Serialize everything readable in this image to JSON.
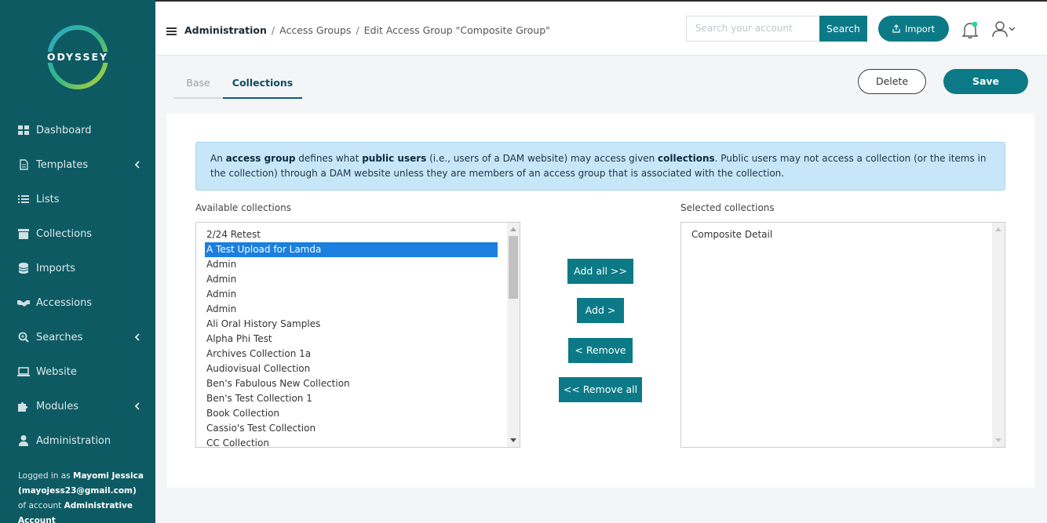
{
  "app": {
    "brand": "ODYSSEY"
  },
  "colors": {
    "sidebar": "#0d5a63",
    "accent": "#0b7a86",
    "selected": "#1b7fe0",
    "info_bg": "#c7e6f8"
  },
  "sidebar": {
    "items": [
      {
        "label": "Dashboard",
        "icon": "dashboard-icon"
      },
      {
        "label": "Templates",
        "icon": "document-icon",
        "has_submenu": true
      },
      {
        "label": "Lists",
        "icon": "list-icon"
      },
      {
        "label": "Collections",
        "icon": "archive-icon"
      },
      {
        "label": "Imports",
        "icon": "database-icon"
      },
      {
        "label": "Accessions",
        "icon": "handshake-icon"
      },
      {
        "label": "Searches",
        "icon": "search-plus-icon",
        "has_submenu": true
      },
      {
        "label": "Website",
        "icon": "laptop-icon"
      },
      {
        "label": "Modules",
        "icon": "puzzle-icon",
        "has_submenu": true
      },
      {
        "label": "Administration",
        "icon": "user-icon"
      }
    ],
    "logged_in": {
      "prefix": "Logged in as",
      "name": "Mayomi Jessica",
      "email": "(mayojess23@gmail.com)",
      "of_account": "of account",
      "account": "Administrative Account"
    }
  },
  "header": {
    "breadcrumb": {
      "root": "Administration",
      "sep": "/",
      "level2": "Access Groups",
      "current": "Edit Access Group \"Composite Group\""
    },
    "search": {
      "placeholder": "Search your account",
      "button": "Search"
    },
    "import_label": "Import"
  },
  "tabs": [
    {
      "label": "Base",
      "active": false
    },
    {
      "label": "Collections",
      "active": true
    }
  ],
  "actions": {
    "delete": "Delete",
    "save": "Save"
  },
  "info": {
    "t1": "An ",
    "b1": "access group",
    "t2": " defines what ",
    "b2": "public users",
    "t3": " (i.e., users of a DAM website) may access given ",
    "b3": "collections",
    "t4": ". Public users may not access a collection (or the items in the collection) through a DAM website unless they are members of an access group that is associated with the collection."
  },
  "available": {
    "label": "Available collections",
    "items": [
      "2/24 Retest",
      "A Test Upload for Lamda",
      "Admin",
      "Admin",
      "Admin",
      "Admin",
      "Ali Oral History Samples",
      "Alpha Phi Test",
      "Archives Collection 1a",
      "Audiovisual Collection",
      "Ben's Fabulous New Collection",
      "Ben's Test Collection 1",
      "Book Collection",
      "Cassio's Test Collection",
      "CC Collection"
    ],
    "selected_index": 1
  },
  "selected": {
    "label": "Selected collections",
    "items": [
      "Composite Detail"
    ]
  },
  "move_buttons": {
    "add_all": "Add all >>",
    "add": "Add >",
    "remove": "< Remove",
    "remove_all": "<< Remove all"
  }
}
